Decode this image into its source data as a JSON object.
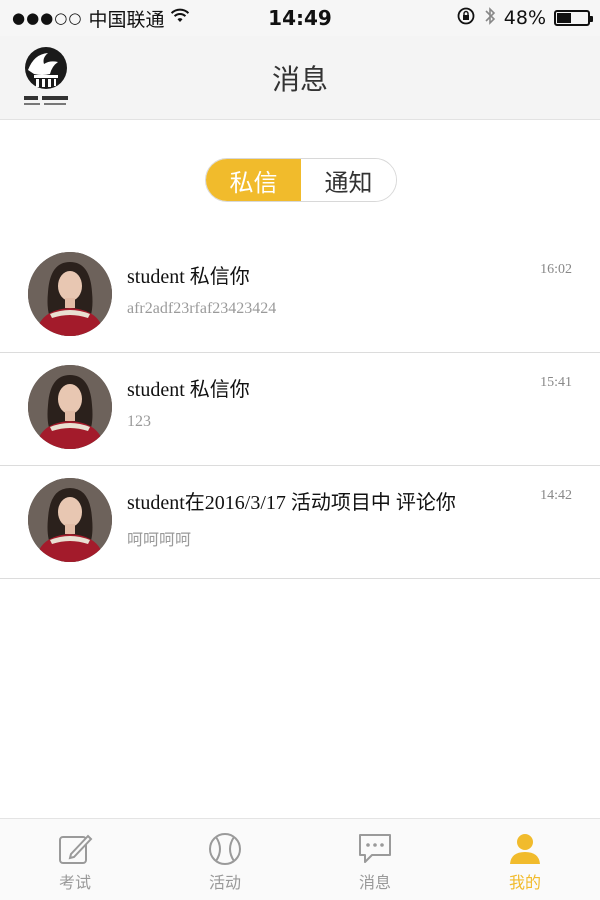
{
  "status_bar": {
    "signal": "●●●○○",
    "carrier": "中国联通",
    "time": "14:49",
    "battery_percent_label": "48%",
    "battery_level": 0.48
  },
  "nav": {
    "title": "消息"
  },
  "segments": {
    "tabs": [
      {
        "label": "私信",
        "active": true
      },
      {
        "label": "通知",
        "active": false
      }
    ]
  },
  "messages": [
    {
      "title": "student 私信你",
      "preview": "afr2adf23rfaf23423424",
      "time": "16:02"
    },
    {
      "title": "student 私信你",
      "preview": "123",
      "time": "15:41"
    },
    {
      "title": "student在2016/3/17 活动项目中 评论你",
      "preview": "呵呵呵呵",
      "time": "14:42"
    }
  ],
  "tab_bar": {
    "items": [
      {
        "label": "考试",
        "icon": "edit-icon",
        "active": false
      },
      {
        "label": "活动",
        "icon": "ball-icon",
        "active": false
      },
      {
        "label": "消息",
        "icon": "chat-icon",
        "active": false
      },
      {
        "label": "我的",
        "icon": "user-icon",
        "active": true
      }
    ]
  },
  "colors": {
    "accent": "#f1bb2c",
    "divider": "#dcdcdc",
    "muted_text": "#9a9a9a"
  }
}
